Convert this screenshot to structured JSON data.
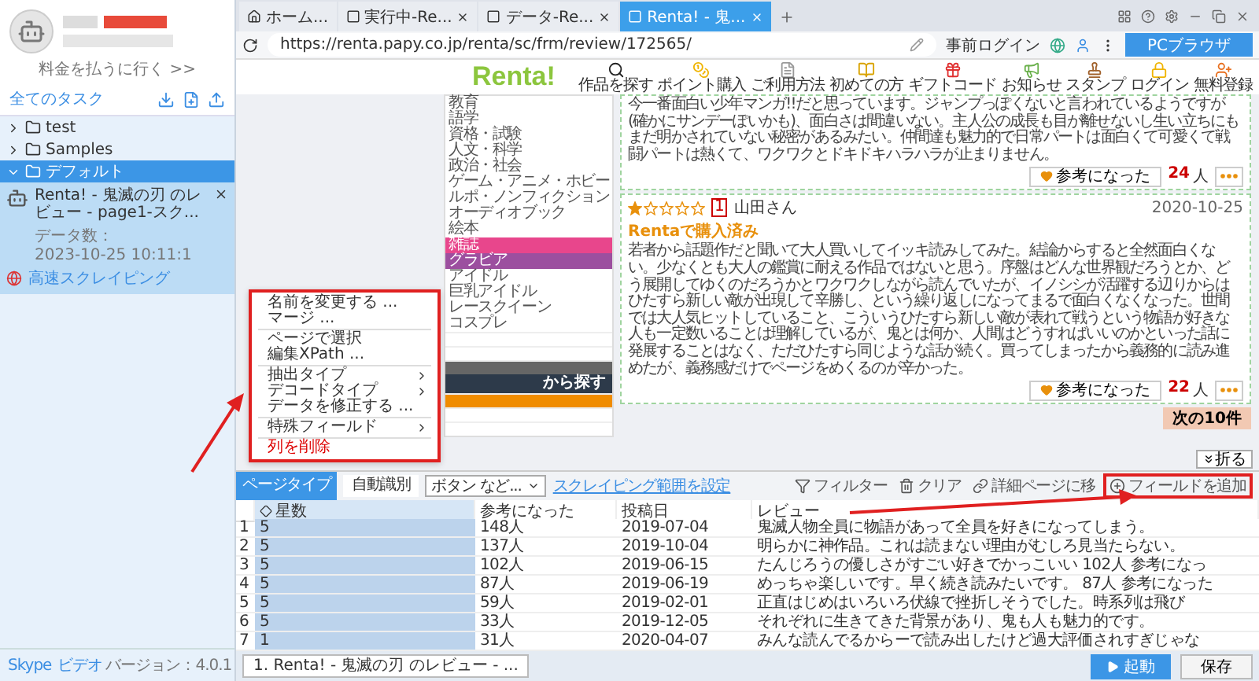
{
  "sidebar": {
    "billing_link": "料金を払うに行く >>",
    "tasks_title": "全てのタスク",
    "folders": [
      {
        "name": "test",
        "expanded": false,
        "selected": false
      },
      {
        "name": "Samples",
        "expanded": false,
        "selected": false
      },
      {
        "name": "デフォルト",
        "expanded": true,
        "selected": true,
        "tasks": [
          {
            "name": "Renta! - 鬼滅の刃 のレビュー - page1-スク...",
            "count_label": "データ数：",
            "time": "2023-10-25 10:11:1",
            "mode": "高速スクレイピング"
          }
        ]
      }
    ],
    "footer": {
      "skype": "Skype",
      "video": "ビデオ",
      "version": "バージョン：4.0.1"
    }
  },
  "browser": {
    "tabs": [
      {
        "kind": "home",
        "label": "ホーム...",
        "selected": false
      },
      {
        "kind": "page",
        "label": "実行中-Re...",
        "selected": false
      },
      {
        "kind": "page",
        "label": "データ-Re...",
        "selected": false
      },
      {
        "kind": "page",
        "label": "Renta! - 鬼...",
        "selected": true
      }
    ],
    "url": "https://renta.papy.co.jp/renta/sc/frm/review/172565/",
    "login": "事前ログイン",
    "mode_button": "PCブラウザ"
  },
  "page": {
    "logo": "Renta!",
    "nav": [
      {
        "kind": "search",
        "label": "作品を探す"
      },
      {
        "kind": "points",
        "label": "ポイント購入"
      },
      {
        "kind": "guide",
        "label": "ご利用方法"
      },
      {
        "kind": "beginner",
        "label": "初めての方"
      },
      {
        "kind": "gift",
        "label": "ギフトコード"
      },
      {
        "kind": "news",
        "label": "お知らせ"
      },
      {
        "kind": "stamp",
        "label": "スタンプ"
      },
      {
        "kind": "login",
        "label": "ログイン"
      },
      {
        "kind": "register",
        "label": "無料登録"
      }
    ],
    "categories": [
      {
        "label": "教育"
      },
      {
        "label": "語学"
      },
      {
        "label": "資格・試験"
      },
      {
        "label": "人文・科学"
      },
      {
        "label": "政治・社会"
      },
      {
        "label": "ゲーム・アニメ・ホビー"
      },
      {
        "label": "ルポ・ノンフィクション"
      },
      {
        "label": "オーディオブック"
      },
      {
        "label": "絵本"
      },
      {
        "label": "雑誌",
        "color": "#e8468c"
      },
      {
        "label": "グラビア",
        "color": "#9c4f9f"
      },
      {
        "label": "アイドル"
      },
      {
        "label": "巨乳アイドル"
      },
      {
        "label": "レースクイーン"
      },
      {
        "label": "コスプレ"
      }
    ],
    "section_header": "から探す",
    "reviews": [
      {
        "text": "今一番面白い少年マンガ!!だと思っています。ジャンプっぽくないと言われているようですが(確かにサンデーぽいかも)、面白さは間違いない。主人公の成長も目が離せないし生い立ちにもまだ明かされていない秘密があるみたい。仲間達も魅力的で日常パートは面白くて可愛くて戦闘パートは熱くて、ワクワクとドキドキハラハラが止まりません。",
        "helpful": "参考になった",
        "count": "24",
        "unit": "人"
      },
      {
        "stars": 1,
        "badge": "1",
        "author": "山田さん",
        "date": "2020-10-25",
        "purchased": "Rentaで購入済み",
        "text": "若者から話題作だと聞いて大人買いしてイッキ読みしてみた。結論からすると全然面白くない。少なくとも大人の鑑賞に耐える作品ではないと思う。序盤はどんな世界観だろうとか、どう展開してゆくのだろうかとワクワクしながら読んでいたが、イノシシが活躍する辺りからはひたすら新しい敵が出現して辛勝し、という繰り返しになってまるで面白くなくなった。世間では大人気ヒットしていること、こういうひたすら新しい敵が表れて戦うという物語が好きな人も一定数いることは理解しているが、鬼とは何か、人間はどうすればいいのかといった話に発展することはなく、ただひたすら同じような話が続く。買ってしまったから義務的に読み進めたが、義務感だけでページをめくるのが辛かった。",
        "helpful": "参考になった",
        "count": "22",
        "unit": "人"
      }
    ],
    "next_button": "次の10件",
    "collapse_button": "折る"
  },
  "context_menu": {
    "groups": [
      {
        "items": [
          {
            "kind": "action",
            "label": "名前を変更する ..."
          },
          {
            "kind": "action",
            "label": "マージ ..."
          }
        ]
      },
      {
        "items": [
          {
            "kind": "action",
            "label": "ページで選択"
          },
          {
            "kind": "action",
            "label": "編集XPath ..."
          }
        ]
      },
      {
        "items": [
          {
            "kind": "submenu",
            "label": "抽出タイプ"
          },
          {
            "kind": "submenu",
            "label": "デコードタイプ"
          },
          {
            "kind": "action",
            "label": "データを修正する ..."
          }
        ]
      },
      {
        "items": [
          {
            "kind": "submenu",
            "label": "特殊フィールド"
          }
        ]
      },
      {
        "items": [
          {
            "kind": "danger",
            "label": "列を削除"
          }
        ]
      }
    ]
  },
  "extractor": {
    "page_type_label": "ページタイプ",
    "page_type_value": "自動識別",
    "dropdown": "ボタン など...",
    "range_link": "スクレイピング範囲を設定",
    "actions": [
      {
        "kind": "filter",
        "label": "フィルター",
        "highlighted": false
      },
      {
        "kind": "clear",
        "label": "クリア",
        "highlighted": false
      },
      {
        "kind": "link",
        "label": "詳細ページに移",
        "highlighted": false
      },
      {
        "kind": "add",
        "label": "フィールドを追加",
        "highlighted": true
      }
    ],
    "columns": [
      {
        "label": "星数",
        "selected": true
      },
      {
        "label": "参考になった",
        "selected": false
      },
      {
        "label": "投稿日",
        "selected": false
      },
      {
        "label": "レビュー",
        "selected": false
      }
    ],
    "rows": [
      {
        "index": "1",
        "cells": [
          "5",
          "148人",
          "2019-07-04",
          "鬼滅人物全員に物語があって全員を好きになってしまう。"
        ]
      },
      {
        "index": "2",
        "cells": [
          "5",
          "137人",
          "2019-10-04",
          "明らかに神作品。これは読まない理由がむしろ見当たらない。"
        ]
      },
      {
        "index": "3",
        "cells": [
          "5",
          "102人",
          "2019-06-15",
          "たんじろうの優しさがすごい好きでかっこいい 102人 参考になっ"
        ]
      },
      {
        "index": "4",
        "cells": [
          "5",
          "87人",
          "2019-06-19",
          "めっちゃ楽しいです。早く続き読みたいです。 87人 参考になった"
        ]
      },
      {
        "index": "5",
        "cells": [
          "5",
          "59人",
          "2019-02-01",
          "正直はじめはいろいろ伏線で挫折しそうでした。時系列は飛び"
        ]
      },
      {
        "index": "6",
        "cells": [
          "5",
          "33人",
          "2019-12-05",
          "それぞれに生きてきた背景があり、鬼も人も魅力的です。"
        ]
      },
      {
        "index": "7",
        "cells": [
          "1",
          "31人",
          "2020-04-07",
          "みんな読んでるからーで読み出したけど過大評価されすぎじゃな"
        ]
      }
    ],
    "task_tab": "1. Renta! - 鬼滅の刃 のレビュー - ...",
    "run_button": "起動",
    "save_button": "保存"
  }
}
